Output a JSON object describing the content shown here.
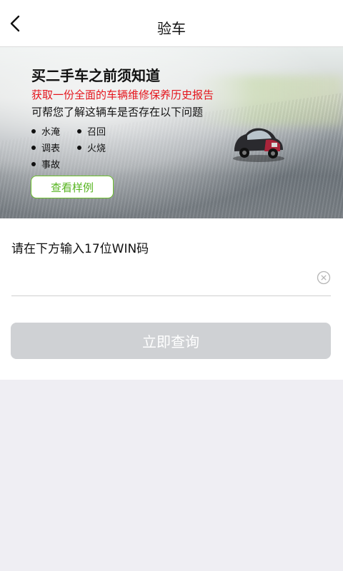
{
  "header": {
    "title": "验车"
  },
  "banner": {
    "title": "买二手车之前须知道",
    "subtitle": "获取一份全面的车辆维修保养历史报告",
    "description": "可帮您了解这辆车是否存在以下问题",
    "issues": [
      "水淹",
      "召回",
      "调表",
      "火烧",
      "事故"
    ],
    "sample_button": "查看样例"
  },
  "form": {
    "prompt": "请在下方输入17位WIN码",
    "vin_value": "",
    "query_button": "立即查询"
  },
  "colors": {
    "accent_red": "#e5141c",
    "accent_green": "#56b41f",
    "disabled_button": "#cfd1d4",
    "page_background": "#efeef3"
  }
}
